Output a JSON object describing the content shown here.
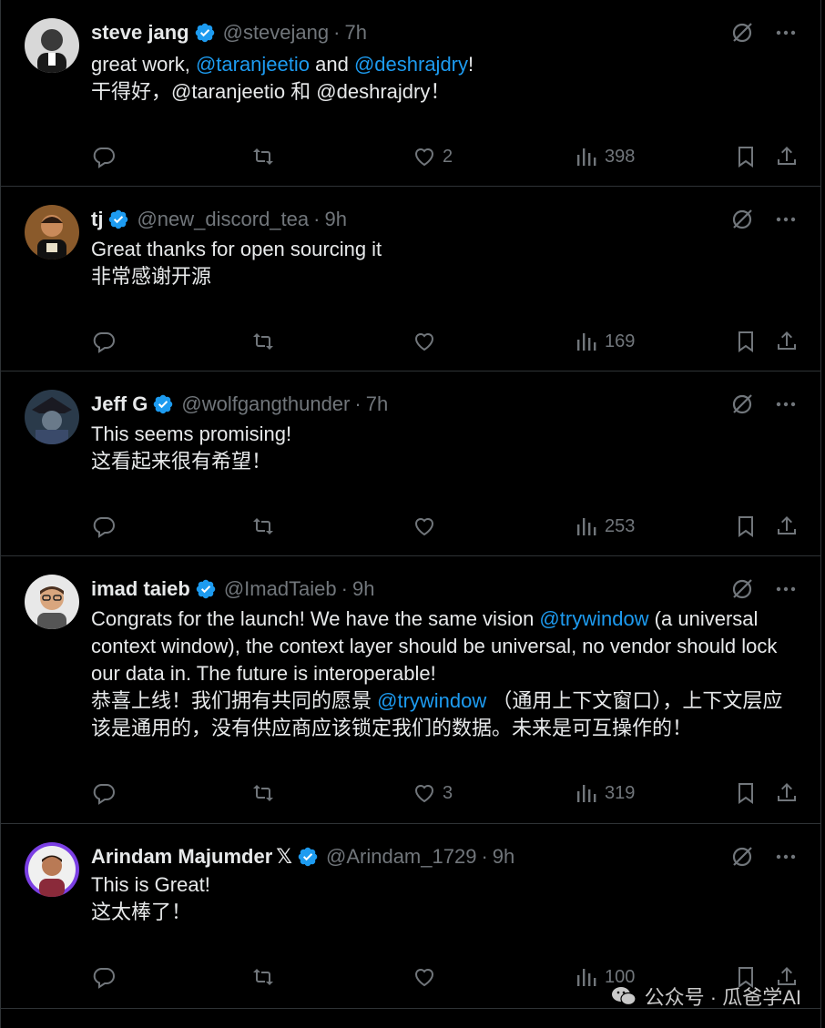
{
  "colors": {
    "accent": "#1d9bf0",
    "verified": "#1d9bf0",
    "muted": "#71767b",
    "text": "#e7e9ea",
    "divider": "#2f3336"
  },
  "tweets": [
    {
      "name": "steve jang",
      "handle": "@stevejang",
      "time": "7h",
      "x_badge": "",
      "text_parts": [
        "great work, ",
        "@taranjeetio",
        " and ",
        "@deshrajdry",
        "!"
      ],
      "translation_parts": [
        "干得好，@taranjeetio 和 @deshrajdry！"
      ],
      "likes": "2",
      "views": "398"
    },
    {
      "name": "tj",
      "handle": "@new_discord_tea",
      "time": "9h",
      "x_badge": "",
      "text_parts": [
        "Great thanks for open sourcing it"
      ],
      "translation_parts": [
        "非常感谢开源"
      ],
      "likes": "",
      "views": "169"
    },
    {
      "name": "Jeff G",
      "handle": "@wolfgangthunder",
      "time": "7h",
      "x_badge": "",
      "text_parts": [
        "This seems promising!"
      ],
      "translation_parts": [
        "这看起来很有希望！"
      ],
      "likes": "",
      "views": "253"
    },
    {
      "name": "imad taieb",
      "handle": "@ImadTaieb",
      "time": "9h",
      "x_badge": "",
      "text_parts": [
        "Congrats for the launch! We have the same vision ",
        "@trywindow",
        " (a universal context window), the context layer should be universal, no vendor should lock our data in. The future is interoperable!"
      ],
      "translation_parts": [
        "恭喜上线！我们拥有共同的愿景 ",
        "@trywindow",
        " （通用上下文窗口），上下文层应该是通用的，没有供应商应该锁定我们的数据。未来是可互操作的！"
      ],
      "likes": "3",
      "views": "319"
    },
    {
      "name": "Arindam Majumder",
      "handle": "@Arindam_1729",
      "time": "9h",
      "x_badge": "𝕏",
      "text_parts": [
        "This is Great!"
      ],
      "translation_parts": [
        "这太棒了！"
      ],
      "likes": "",
      "views": "100"
    }
  ],
  "separator": "·",
  "watermark": "公众号 · 瓜爸学AI",
  "icons": {
    "reply": "reply-icon",
    "retweet": "retweet-icon",
    "like": "heart-icon",
    "views": "views-icon",
    "bookmark": "bookmark-icon",
    "share": "share-icon",
    "grok": "grok-icon",
    "more": "more-icon",
    "verified": "verified-badge-icon"
  }
}
